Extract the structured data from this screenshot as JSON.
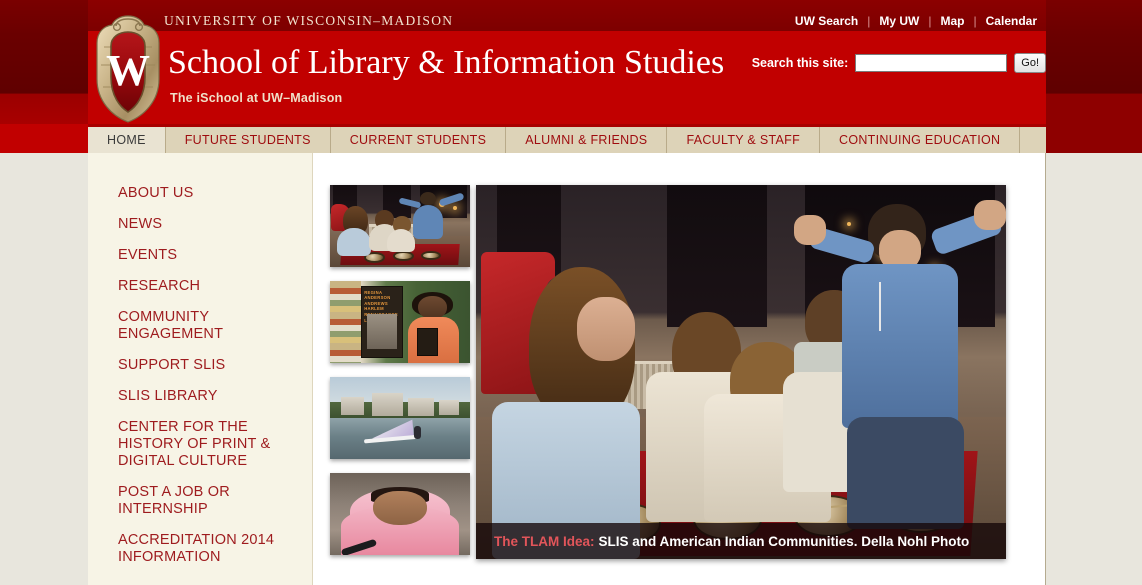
{
  "banner": {
    "university": "UNIVERSITY OF WISCONSIN–MADISON",
    "site_title": "School of Library & Information Studies",
    "subtitle": "The iSchool at UW–Madison",
    "crest_icon": "uw-crest-icon",
    "colors": {
      "banner_red": "#c10000",
      "banner_dark_red": "#6d0000",
      "nav_tan": "#ddd3b8",
      "nav_active_tan": "#e9e3d2",
      "link_red": "#9e1b1e",
      "page_bg": "#e8e6dd"
    }
  },
  "utility_nav": {
    "items": [
      {
        "label": "UW Search"
      },
      {
        "label": "My UW"
      },
      {
        "label": "Map"
      },
      {
        "label": "Calendar"
      }
    ],
    "separator": "|"
  },
  "search": {
    "label": "Search this site:",
    "value": "",
    "placeholder": "",
    "button_label": "Go!"
  },
  "main_nav": {
    "tabs": [
      {
        "label": "HOME",
        "active": true
      },
      {
        "label": "FUTURE STUDENTS",
        "active": false
      },
      {
        "label": "CURRENT STUDENTS",
        "active": false
      },
      {
        "label": "ALUMNI & FRIENDS",
        "active": false
      },
      {
        "label": "FACULTY & STAFF",
        "active": false
      },
      {
        "label": "CONTINUING EDUCATION",
        "active": false
      }
    ]
  },
  "sidebar": {
    "items": [
      {
        "label": "ABOUT US"
      },
      {
        "label": "NEWS"
      },
      {
        "label": "EVENTS"
      },
      {
        "label": "RESEARCH"
      },
      {
        "label": "COMMUNITY ENGAGEMENT"
      },
      {
        "label": "SUPPORT SLIS"
      },
      {
        "label": "SLIS LIBRARY"
      },
      {
        "label": "CENTER FOR THE HISTORY OF PRINT & DIGITAL CULTURE"
      },
      {
        "label": "POST A JOB OR INTERNSHIP"
      },
      {
        "label": "ACCREDITATION 2014 INFORMATION"
      }
    ]
  },
  "feature": {
    "thumbnails": [
      {
        "name": "thumbnail-tlam",
        "alt": "Students kneeling around a red blanket with artifacts",
        "selected": true
      },
      {
        "name": "thumbnail-book",
        "alt": "Woman holding the book Regina Anderson Andrews: Harlem Renaissance Librarian",
        "selected": false
      },
      {
        "name": "thumbnail-lake",
        "alt": "Windsurfer on Lake Mendota in front of campus buildings",
        "selected": false
      },
      {
        "name": "thumbnail-portrait",
        "alt": "Young woman in a pink headscarf speaking at a microphone",
        "selected": false
      }
    ],
    "hero": {
      "alt": "Students and instructor gathered around a red blanket with American Indian artifacts",
      "caption_lead": "The TLAM Idea:",
      "caption_text": "SLIS and American Indian Communities. Della Nohl Photo"
    },
    "book_cover_text": "REGINA ANDERSON ANDREWS HARLEM RENAISSANCE LIBRARIAN"
  }
}
